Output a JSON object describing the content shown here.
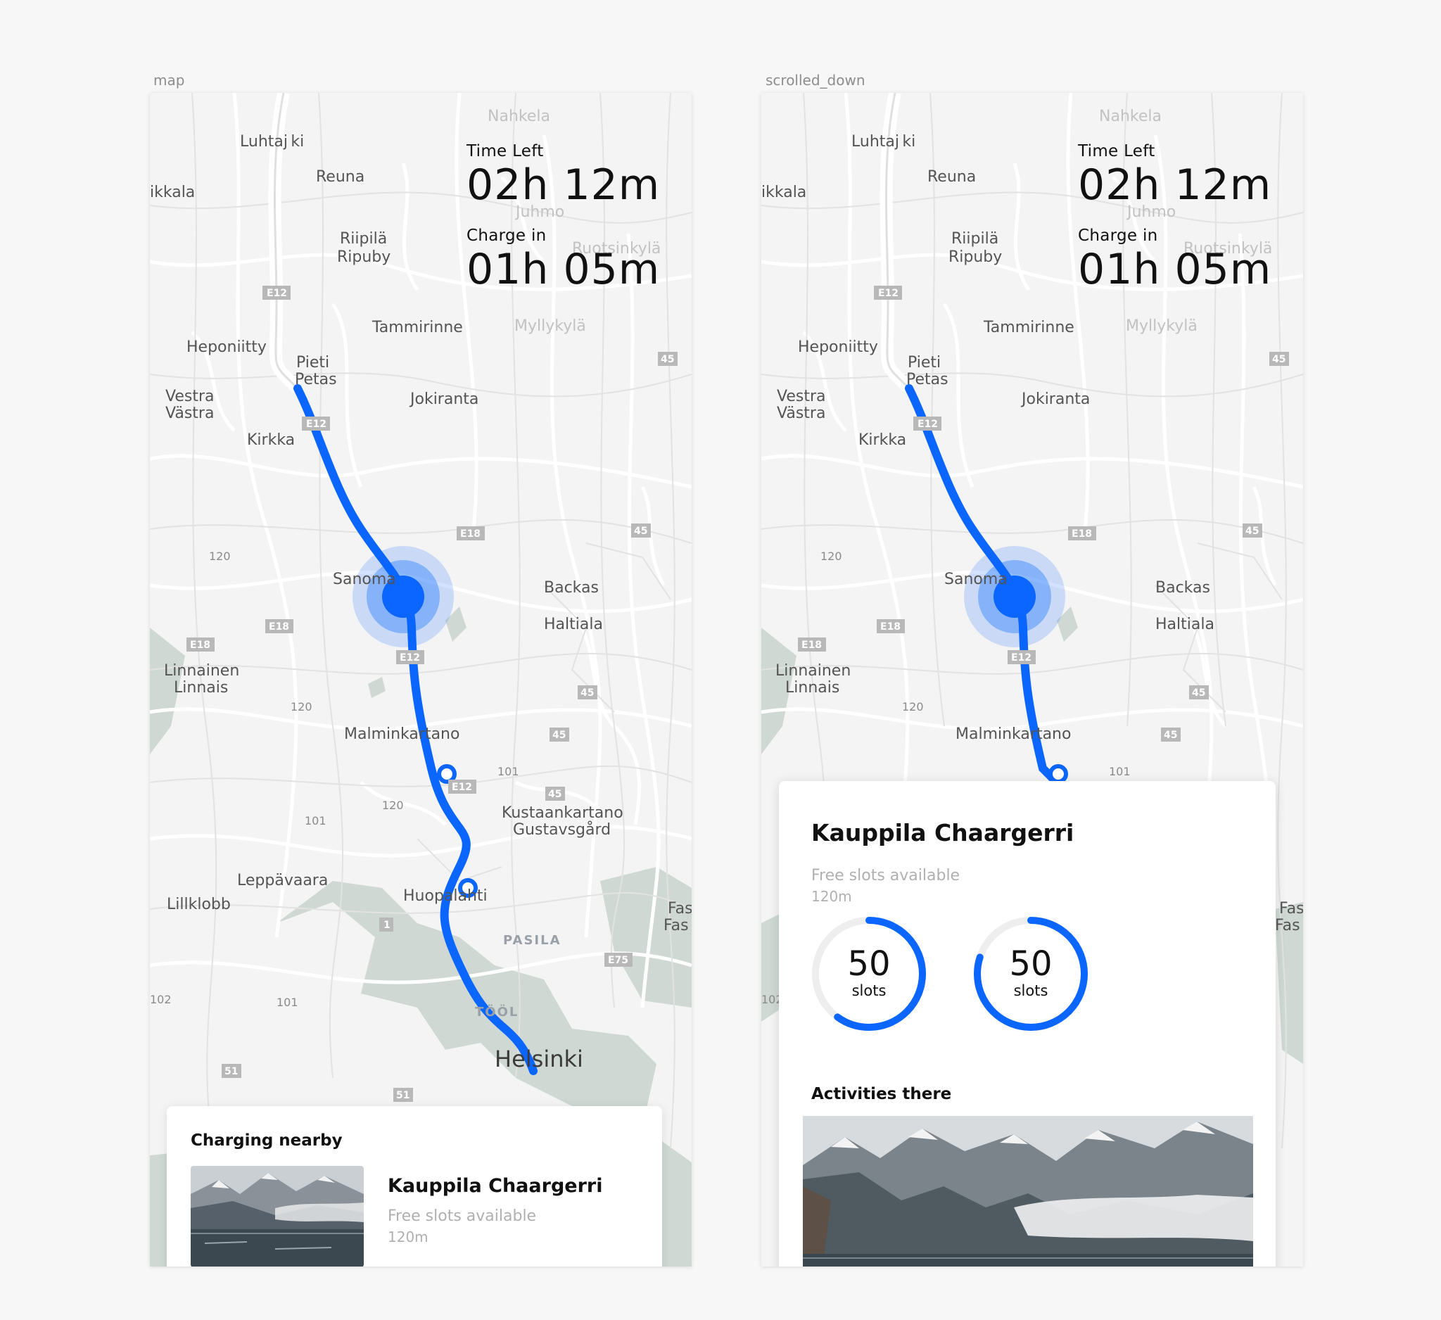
{
  "frames": [
    {
      "label": "map"
    },
    {
      "label": "scrolled_down"
    }
  ],
  "stats": {
    "time_left_label": "Time Left",
    "time_left_value": "02h 12m",
    "charge_in_label": "Charge in",
    "charge_in_value": "01h 05m"
  },
  "map": {
    "places": {
      "nahkela": "Nahkela",
      "luhtajoki": "Luhtaj ki",
      "reuna": "Reuna",
      "ikkala": "ikkala",
      "juhmo": "Juhmo",
      "riipila": "Riipilä",
      "ripuby": "Ripuby",
      "ruotsinkyla": "Ruotsinkylä",
      "tammirinne": "Tammirinne",
      "myllykyla": "Myllykylä",
      "heponiitty": "Heponiitty",
      "pieti": "Pieti",
      "petas": "Petas",
      "vestra": "Vestra",
      "vastra": "Västra",
      "jokiranta": "Jokiranta",
      "kirkka": "Kirkka",
      "sanoma": "Sanoma",
      "backas": "Backas",
      "haltiala": "Haltiala",
      "linnainen": "Linnainen",
      "linnais": "Linnais",
      "malminkartano": "Malminkartano",
      "kustaankartano": "Kustaankartano",
      "gustavsgard": "Gustavsgård",
      "leppavaara": "Leppävaara",
      "lillklobb": "Lillklobb",
      "huopalahti": "Huopalahti",
      "pasila": "PASILA",
      "toolo": "TÖÖL",
      "helsinki": "Helsinki",
      "fas1": "Fas",
      "fas2": "Fas"
    },
    "road_numbers": {
      "r120a": "120",
      "r120b": "120",
      "r120c": "120",
      "r101a": "101",
      "r101b": "101",
      "r101c": "101",
      "r102": "102"
    },
    "shields": {
      "e12a": "E12",
      "e12b": "E12",
      "e18a": "E18",
      "e18b": "E18",
      "e18c": "E18",
      "e12c": "E12",
      "e12d": "E12",
      "s45a": "45",
      "s45b": "45",
      "s45c": "45",
      "s45d": "45",
      "s45e": "45",
      "s1": "1",
      "e75": "E75",
      "s51a": "51",
      "s51b": "51"
    },
    "route_color": "#0a66ff"
  },
  "nearby_card": {
    "title": "Charging nearby",
    "station_name": "Kauppila Chaargerri",
    "availability": "Free slots available",
    "distance": "120m"
  },
  "detail_card": {
    "station_name": "Kauppila Chaargerri",
    "availability": "Free slots available",
    "distance": "120m",
    "gauges": [
      {
        "value": "50",
        "unit": "slots",
        "fill_fraction": 0.6
      },
      {
        "value": "50",
        "unit": "slots",
        "fill_fraction": 0.8
      }
    ],
    "activities_title": "Activities there"
  }
}
